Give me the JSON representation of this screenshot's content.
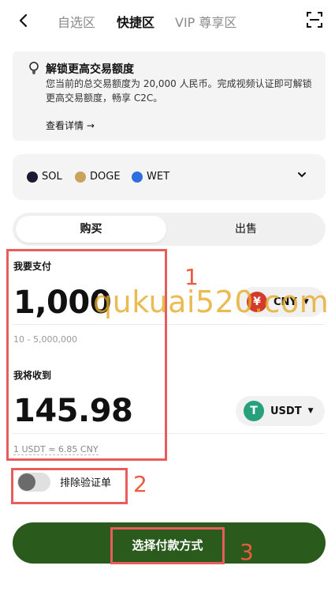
{
  "nav": {
    "back_icon": "chevron-left-icon",
    "tabs": [
      {
        "label": "自选区",
        "active": false
      },
      {
        "label": "快捷区",
        "active": true
      },
      {
        "label": "VIP 尊享区",
        "active": false
      }
    ],
    "scan_icon": "scan-icon"
  },
  "notice": {
    "title": "解锁更高交易额度",
    "body": "您当前的总交易额度为 20,000 人民币。完成视频认证即可解锁更高交易额度，畅享 C2C。",
    "link": "查看详情 →"
  },
  "coins": {
    "items": [
      {
        "label": "SOL",
        "color": "#1b1b2f"
      },
      {
        "label": "DOGE",
        "color": "#c9a25c"
      },
      {
        "label": "WET",
        "color": "#2e6fe0"
      }
    ]
  },
  "segment": {
    "buy": "购买",
    "sell": "出售"
  },
  "pay": {
    "label": "我要支付",
    "amount": "1,000",
    "range": "10 - 5,000,000",
    "currency": "CNY",
    "currency_symbol": "¥",
    "currency_color": "#d23b2b"
  },
  "receive": {
    "label": "我将收到",
    "amount": "145.98",
    "rate": "1 USDT ≈ 6.85 CNY",
    "currency": "USDT",
    "currency_symbol": "T",
    "currency_color": "#26a17b"
  },
  "toggle": {
    "label": "排除验证单",
    "on": false
  },
  "cta": {
    "label": "选择付款方式"
  },
  "annotations": {
    "one": "1",
    "two": "2",
    "three": "3"
  },
  "watermark": "qukuai520.com",
  "colors": {
    "accent": "#2a5b1c",
    "annotation": "#e85c5c"
  }
}
